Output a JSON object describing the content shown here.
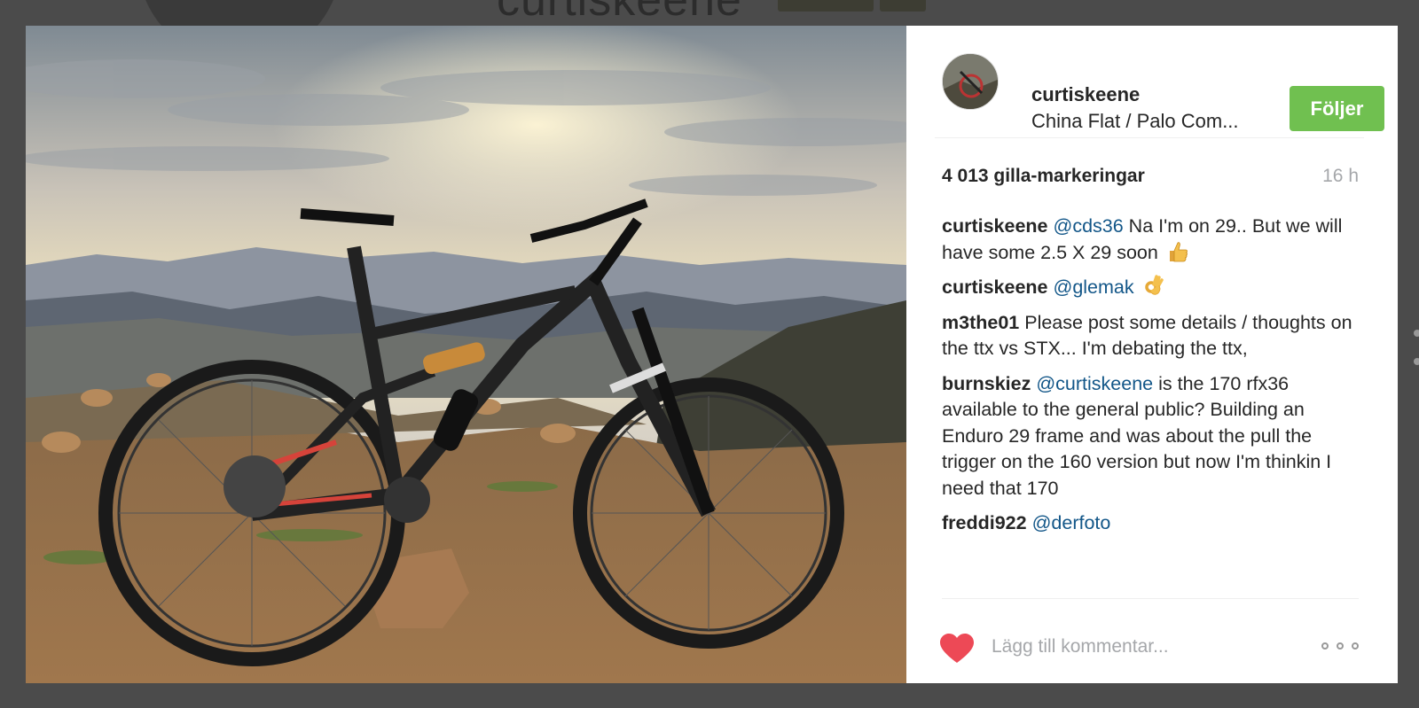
{
  "background": {
    "username": "curtiskeene"
  },
  "post": {
    "photo_icon": "mountain-bike-photo",
    "header": {
      "username": "curtiskeene",
      "location": "China Flat / Palo Com...",
      "follow_label": "Följer",
      "follow_color": "#70c050"
    },
    "likes": "4 013 gilla-markeringar",
    "timestamp": "16 h",
    "comments": [
      {
        "author": "curtiskeene",
        "mention": "@cds36",
        "text": " Na I'm on 29.. But we will have some 2.5 X 29 soon",
        "emoji": "thumbs-up-emoji"
      },
      {
        "author": "curtiskeene",
        "mention": "@glemak",
        "text": "",
        "emoji": "ok-hand-emoji"
      },
      {
        "author": "m3the01",
        "mention": "",
        "text": " Please post some details / thoughts on the ttx vs STX... I'm debating the ttx,"
      },
      {
        "author": "burnskiez",
        "mention": "@curtiskeene",
        "text": " is the 170 rfx36 available to the general public? Building an Enduro 29 frame and was about the pull the trigger on the 160 version but now I'm thinkin I need that 170"
      },
      {
        "author": "freddi922",
        "mention": "@derfoto",
        "text": ""
      }
    ],
    "footer": {
      "comment_placeholder": "Lägg till kommentar...",
      "heart_color": "#ed4956",
      "mention_color": "#125688"
    }
  }
}
